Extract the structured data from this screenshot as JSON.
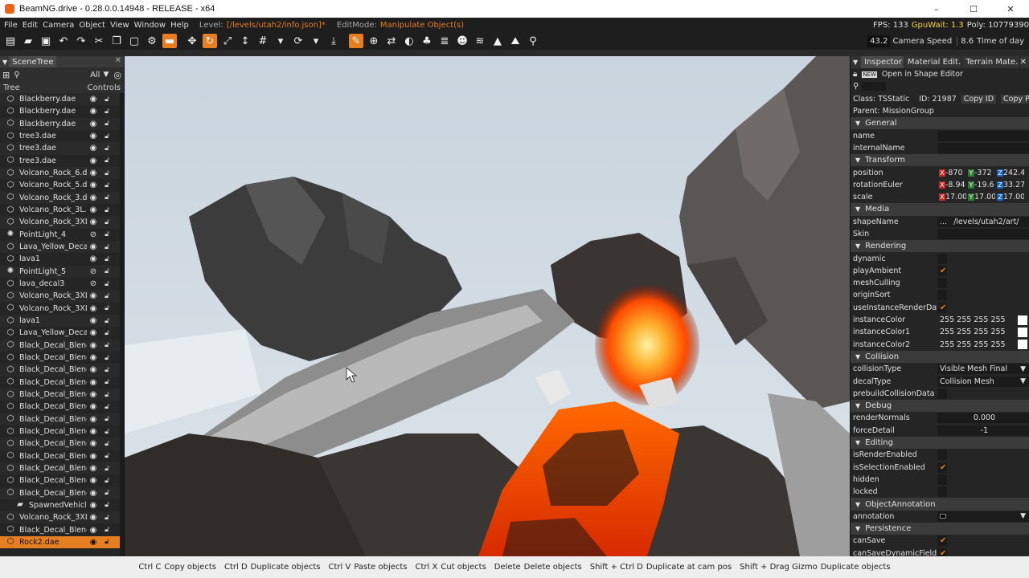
{
  "window": {
    "title": "BeamNG.drive - 0.28.0.0.14948 - RELEASE - x64",
    "minimize": "–",
    "maximize": "☐",
    "close": "✕"
  },
  "menu": {
    "items": [
      "File",
      "Edit",
      "Camera",
      "Object",
      "View",
      "Window",
      "Help"
    ],
    "level_label": "Level:",
    "level_path": "[/levels/utah2/info.json]*",
    "editmode_label": "EditMode:",
    "editmode_value": "Manipulate Object(s)",
    "fps": "FPS: 133",
    "gpuwait": "GpuWait: 1.3",
    "poly": "Poly: 10779390"
  },
  "toolbar": {
    "camera_speed_value": "43.2",
    "camera_speed_label": "Camera Speed",
    "time_of_day_value": "8.6",
    "time_of_day_label": "Time of day"
  },
  "scenetree": {
    "tab": "SceneTree",
    "filter": "All",
    "col_tree": "Tree",
    "col_controls": "Controls",
    "items": [
      {
        "label": "Blackberry.dae",
        "icon": "mesh",
        "hidden": false
      },
      {
        "label": "Blackberry.dae",
        "icon": "mesh",
        "hidden": false
      },
      {
        "label": "Blackberry.dae",
        "icon": "mesh",
        "hidden": false
      },
      {
        "label": "tree3.dae",
        "icon": "mesh",
        "hidden": false
      },
      {
        "label": "tree3.dae",
        "icon": "mesh",
        "hidden": false
      },
      {
        "label": "tree3.dae",
        "icon": "mesh",
        "hidden": false
      },
      {
        "label": "Volcano_Rock_6.da",
        "icon": "mesh",
        "hidden": false
      },
      {
        "label": "Volcano_Rock_5.da",
        "icon": "mesh",
        "hidden": false
      },
      {
        "label": "Volcano_Rock_3.da",
        "icon": "mesh",
        "hidden": false
      },
      {
        "label": "Volcano_Rock_3L.d",
        "icon": "mesh",
        "hidden": false
      },
      {
        "label": "Volcano_Rock_3XL.",
        "icon": "mesh",
        "hidden": false
      },
      {
        "label": "PointLight_4",
        "icon": "light",
        "hidden": true
      },
      {
        "label": "Lava_Yellow_Decal_",
        "icon": "mesh",
        "hidden": false
      },
      {
        "label": "lava1",
        "icon": "mesh",
        "hidden": false
      },
      {
        "label": "PointLight_5",
        "icon": "light",
        "hidden": true
      },
      {
        "label": "lava_decal3",
        "icon": "mesh",
        "hidden": true
      },
      {
        "label": "Volcano_Rock_3XL.",
        "icon": "mesh",
        "hidden": false
      },
      {
        "label": "Volcano_Rock_3XL.",
        "icon": "mesh",
        "hidden": false
      },
      {
        "label": "lava1",
        "icon": "mesh",
        "hidden": false
      },
      {
        "label": "Lava_Yellow_Decal_",
        "icon": "mesh",
        "hidden": false
      },
      {
        "label": "Black_Decal_Blend",
        "icon": "mesh",
        "hidden": false
      },
      {
        "label": "Black_Decal_Blend",
        "icon": "mesh",
        "hidden": false
      },
      {
        "label": "Black_Decal_Blend",
        "icon": "mesh",
        "hidden": false
      },
      {
        "label": "Black_Decal_Blend",
        "icon": "mesh",
        "hidden": false
      },
      {
        "label": "Black_Decal_Blend",
        "icon": "mesh",
        "hidden": false
      },
      {
        "label": "Black_Decal_Blend",
        "icon": "mesh",
        "hidden": false
      },
      {
        "label": "Black_Decal_Blend",
        "icon": "mesh",
        "hidden": false
      },
      {
        "label": "Black_Decal_Blend",
        "icon": "mesh",
        "hidden": false
      },
      {
        "label": "Black_Decal_Blend",
        "icon": "mesh",
        "hidden": false
      },
      {
        "label": "Black_Decal_Blend",
        "icon": "mesh",
        "hidden": false
      },
      {
        "label": "Black_Decal_Blend",
        "icon": "mesh",
        "hidden": false
      },
      {
        "label": "Black_Decal_Blend",
        "icon": "mesh",
        "hidden": false
      },
      {
        "label": "Black_Decal_Blend",
        "icon": "mesh",
        "hidden": false
      },
      {
        "label": "SpawnedVehicle",
        "icon": "folder",
        "hidden": false
      },
      {
        "label": "Volcano_Rock_3XL.",
        "icon": "mesh",
        "hidden": false
      },
      {
        "label": "Black_Decal_Blend",
        "icon": "mesh",
        "hidden": false
      },
      {
        "label": "Rock2.dae",
        "icon": "mesh",
        "hidden": false,
        "selected": true
      }
    ]
  },
  "inspector": {
    "tabs": [
      "Inspector",
      "Material Edit.",
      "Terrain Mate."
    ],
    "open_shape_editor": "Open in Shape Editor",
    "class": "Class: TSStatic",
    "id": "ID: 21987",
    "copy_id": "Copy ID",
    "copy_pid": "Copy PID",
    "parent": "Parent: MissionGroup",
    "sections": {
      "general": "General",
      "transform": "Transform",
      "media": "Media",
      "rendering": "Rendering",
      "collision": "Collision",
      "debug": "Debug",
      "editing": "Editing",
      "annotation": "ObjectAnnotation",
      "persistence": "Persistence"
    },
    "fields": {
      "name": "name",
      "internalName": "internalName",
      "position": "position",
      "position_x": "-870",
      "position_y": "-372",
      "position_z": "242.4",
      "rotationEuler": "rotationEuler",
      "rotation_x": "-8.94",
      "rotation_y": "-19.6",
      "rotation_z": "33.27",
      "scale": "scale",
      "scale_x": "17.00",
      "scale_y": "17.00",
      "scale_z": "17.00",
      "shapeName": "shapeName",
      "shapeName_btn": "...",
      "shapeName_value": "/levels/utah2/art/",
      "skin": "Skin",
      "dynamic": "dynamic",
      "playAmbient": "playAmbient",
      "meshCulling": "meshCulling",
      "originSort": "originSort",
      "useInstanceRenderData": "useInstanceRenderData",
      "instanceColor": "instanceColor",
      "instanceColor1": "instanceColor1",
      "instanceColor2": "instanceColor2",
      "color_value": "255  255  255  255",
      "collisionType": "collisionType",
      "collisionType_value": "Visible Mesh Final",
      "decalType": "decalType",
      "decalType_value": "Collision Mesh",
      "prebuildCollisionData": "prebuildCollisionData",
      "renderNormals": "renderNormals",
      "renderNormals_value": "0.000",
      "forceDetail": "forceDetail",
      "forceDetail_value": "-1",
      "isRenderEnabled": "isRenderEnabled",
      "isSelectionEnabled": "isSelectionEnabled",
      "hidden": "hidden",
      "locked": "locked",
      "annotation": "annotation",
      "canSave": "canSave",
      "canSaveDynamicFields": "canSaveDynamicFields"
    }
  },
  "statusbar": [
    {
      "key": "Ctrl C",
      "action": "Copy objects"
    },
    {
      "key": "Ctrl D",
      "action": "Duplicate objects"
    },
    {
      "key": "Ctrl V",
      "action": "Paste objects"
    },
    {
      "key": "Ctrl X",
      "action": "Cut objects"
    },
    {
      "key": "Delete",
      "action": "Delete objects"
    },
    {
      "key": "Shift + Ctrl D",
      "action": "Duplicate at cam pos"
    },
    {
      "key": "Shift + Drag Gizmo",
      "action": "Duplicate objects"
    }
  ],
  "colors": {
    "accent": "#e67e22",
    "gpu": "#f5d442",
    "lava": "#ff4500"
  }
}
